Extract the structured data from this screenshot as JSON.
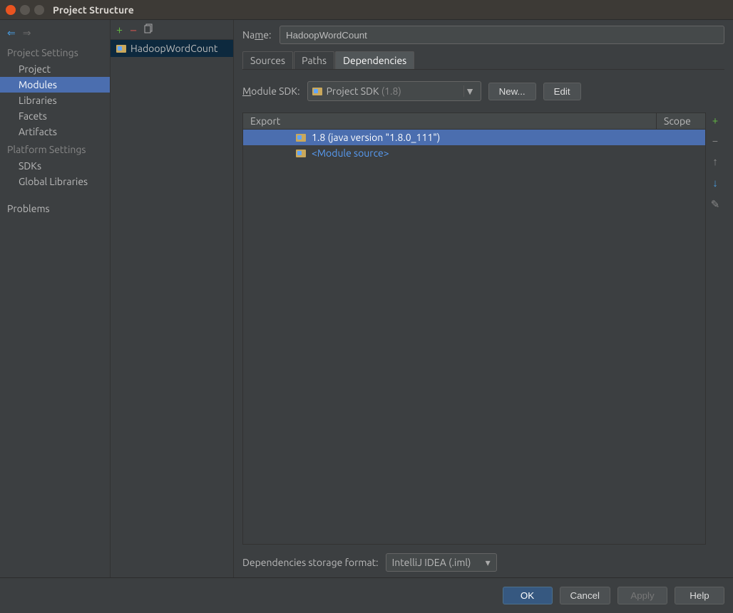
{
  "window": {
    "title": "Project Structure"
  },
  "sidebar": {
    "projectSettingsHeader": "Project Settings",
    "platformSettingsHeader": "Platform Settings",
    "projectItems": [
      "Project",
      "Modules",
      "Libraries",
      "Facets",
      "Artifacts"
    ],
    "platformItems": [
      "SDKs",
      "Global Libraries"
    ],
    "problems": "Problems"
  },
  "modulesList": {
    "items": [
      "HadoopWordCount"
    ]
  },
  "main": {
    "nameLabelPrefix": "Na",
    "nameLabelU": "m",
    "nameLabelSuffix": "e:",
    "nameValue": "HadoopWordCount",
    "tabs": [
      "Sources",
      "Paths",
      "Dependencies"
    ],
    "activeTabIndex": 2,
    "moduleSdkLabelU": "M",
    "moduleSdkLabelRest": "odule SDK:",
    "moduleSdkValue": "Project SDK",
    "moduleSdkSuffix": "(1.8)",
    "newBtn": "New...",
    "editBtn": "Edit",
    "depHeaderExport": "Export",
    "depHeaderScope": "Scope",
    "depRows": [
      {
        "label": "1.8 (java version \"1.8.0_111\")",
        "selected": true,
        "isModuleSrc": false
      },
      {
        "label": "<Module source>",
        "selected": false,
        "isModuleSrc": true
      }
    ],
    "storageLabel": "Dependencies storage format:",
    "storageValue": "IntelliJ IDEA (.iml)"
  },
  "buttons": {
    "ok": "OK",
    "cancel": "Cancel",
    "apply": "Apply",
    "help": "Help"
  }
}
